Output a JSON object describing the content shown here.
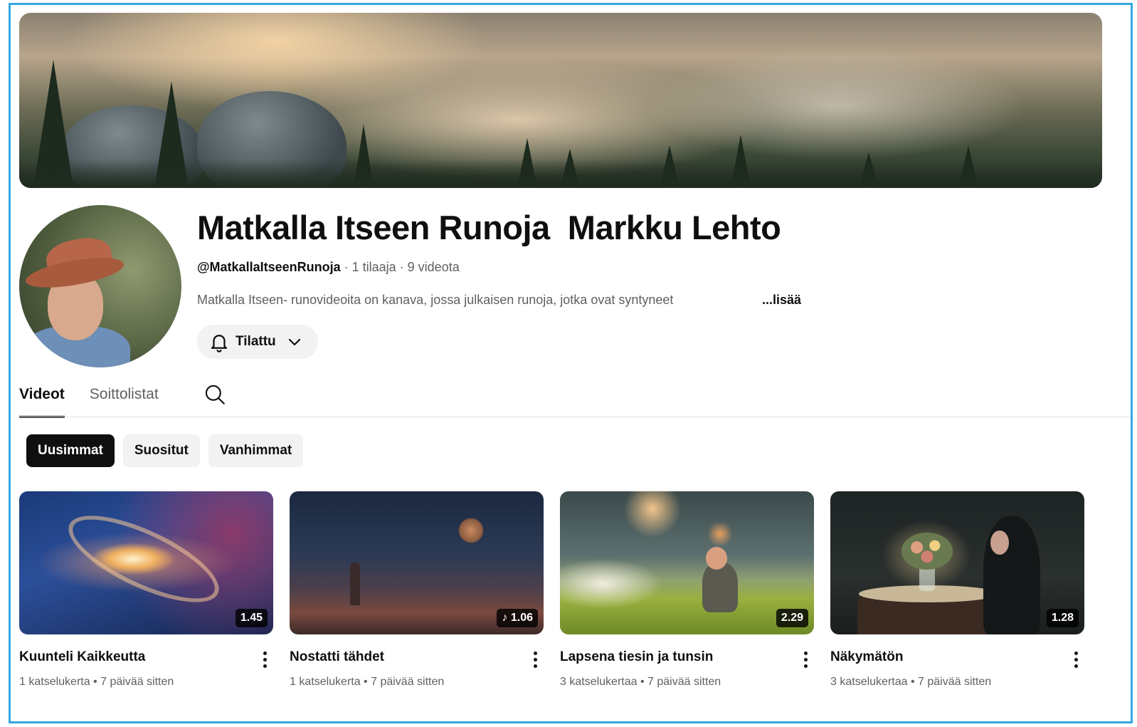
{
  "channel": {
    "title": "Matkalla Itseen Runoja  Markku Lehto",
    "handle": "@MatkallaItseenRunoja",
    "subscribers": "1 tilaaja",
    "video_count": "9 videota",
    "separator": " · ",
    "description": "Matkalla Itseen- runovideoita on kanava, jossa julkaisen runoja, jotka ovat syntyneet",
    "more_label": "...lisää",
    "subscribe_label": "Tilattu"
  },
  "tabs": [
    {
      "label": "Videot",
      "active": true
    },
    {
      "label": "Soittolistat",
      "active": false
    }
  ],
  "filters": [
    {
      "label": "Uusimmat",
      "active": true
    },
    {
      "label": "Suositut",
      "active": false
    },
    {
      "label": "Vanhimmat",
      "active": false
    }
  ],
  "videos": [
    {
      "title": "Kuunteli Kaikkeutta",
      "views": "1 katselukerta",
      "age": "7 päivää sitten",
      "duration": "1.45"
    },
    {
      "title": "Nostatti tähdet",
      "views": "1 katselukerta",
      "age": "7 päivää sitten",
      "duration": "♪ 1.06"
    },
    {
      "title": "Lapsena tiesin ja tunsin",
      "views": "3 katselukertaa",
      "age": "7 päivää sitten",
      "duration": "2.29"
    },
    {
      "title": "Näkymätön",
      "views": "3 katselukertaa",
      "age": "7 päivää sitten",
      "duration": "1.28"
    }
  ],
  "meta_separator": " • ",
  "colors": {
    "frame_border": "#35a8e0",
    "chip_active_bg": "#0f0f0f",
    "chip_bg": "#f2f2f2",
    "secondary_text": "#606060"
  },
  "icons": {
    "subscribe": "bell-icon",
    "subscribe_dropdown": "chevron-down-icon",
    "tab_search": "search-icon",
    "video_menu": "more-vertical-icon"
  }
}
